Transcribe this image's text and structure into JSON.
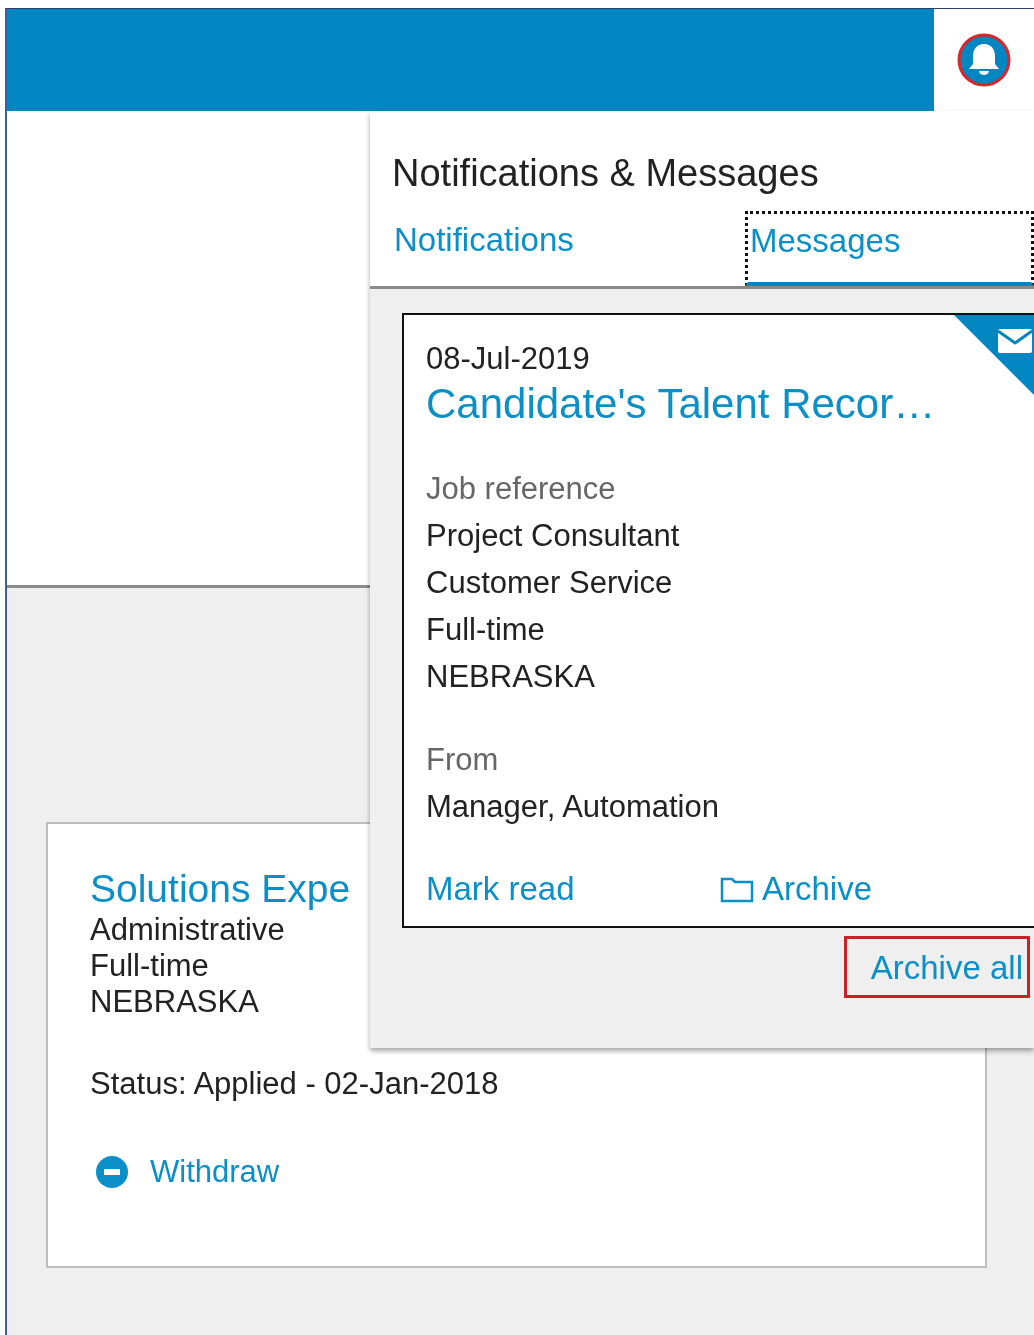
{
  "popup": {
    "title": "Notifications & Messages",
    "tabs": [
      {
        "label": "Notifications",
        "selected": false
      },
      {
        "label": "Messages",
        "selected": true
      }
    ],
    "messages": [
      {
        "date": "08-Jul-2019",
        "title": "Candidate's Talent Recor…",
        "sections": [
          {
            "label": "Job reference",
            "lines": [
              "Project Consultant",
              "Customer Service",
              "Full-time",
              "NEBRASKA"
            ]
          },
          {
            "label": "From",
            "lines": [
              "Manager, Automation"
            ]
          }
        ],
        "actions": [
          {
            "label": "Mark read",
            "kind": "link"
          },
          {
            "label": "Archive",
            "kind": "archive"
          }
        ]
      }
    ],
    "archive_all": "Archive all"
  },
  "application": {
    "title": "Solutions Expe",
    "lines": [
      "Administrative",
      "Full-time",
      "NEBRASKA"
    ],
    "status": "Status: Applied - 02-Jan-2018",
    "withdraw": "Withdraw"
  }
}
